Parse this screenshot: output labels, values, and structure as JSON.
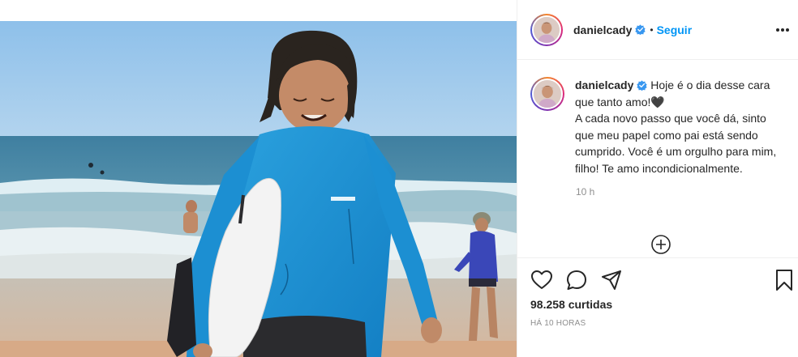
{
  "post": {
    "username": "danielcady",
    "follow_label": "Seguir",
    "dot": "•",
    "caption": {
      "username": "danielcady",
      "text": " Hoje é o dia desse cara que tanto amo!🖤\nA cada novo passo que você dá, sinto que meu papel como pai está sendo cumprido. Você é um orgulho para mim, filho! Te amo incondicionalmente.",
      "time": "10 h"
    },
    "likes": "98.258 curtidas",
    "posted_ago": "HÁ 10 HORAS"
  },
  "icons": {
    "more": "more-options-icon",
    "verified": "verified-badge-icon",
    "load_more": "plus-circle-icon",
    "like": "heart-icon",
    "comment": "comment-bubble-icon",
    "share": "paper-plane-icon",
    "save": "bookmark-icon"
  },
  "colors": {
    "accent": "#0095f6",
    "text": "#262626",
    "muted": "#8e8e8e",
    "border": "#efefef",
    "rashguard": "#1e90d0"
  }
}
